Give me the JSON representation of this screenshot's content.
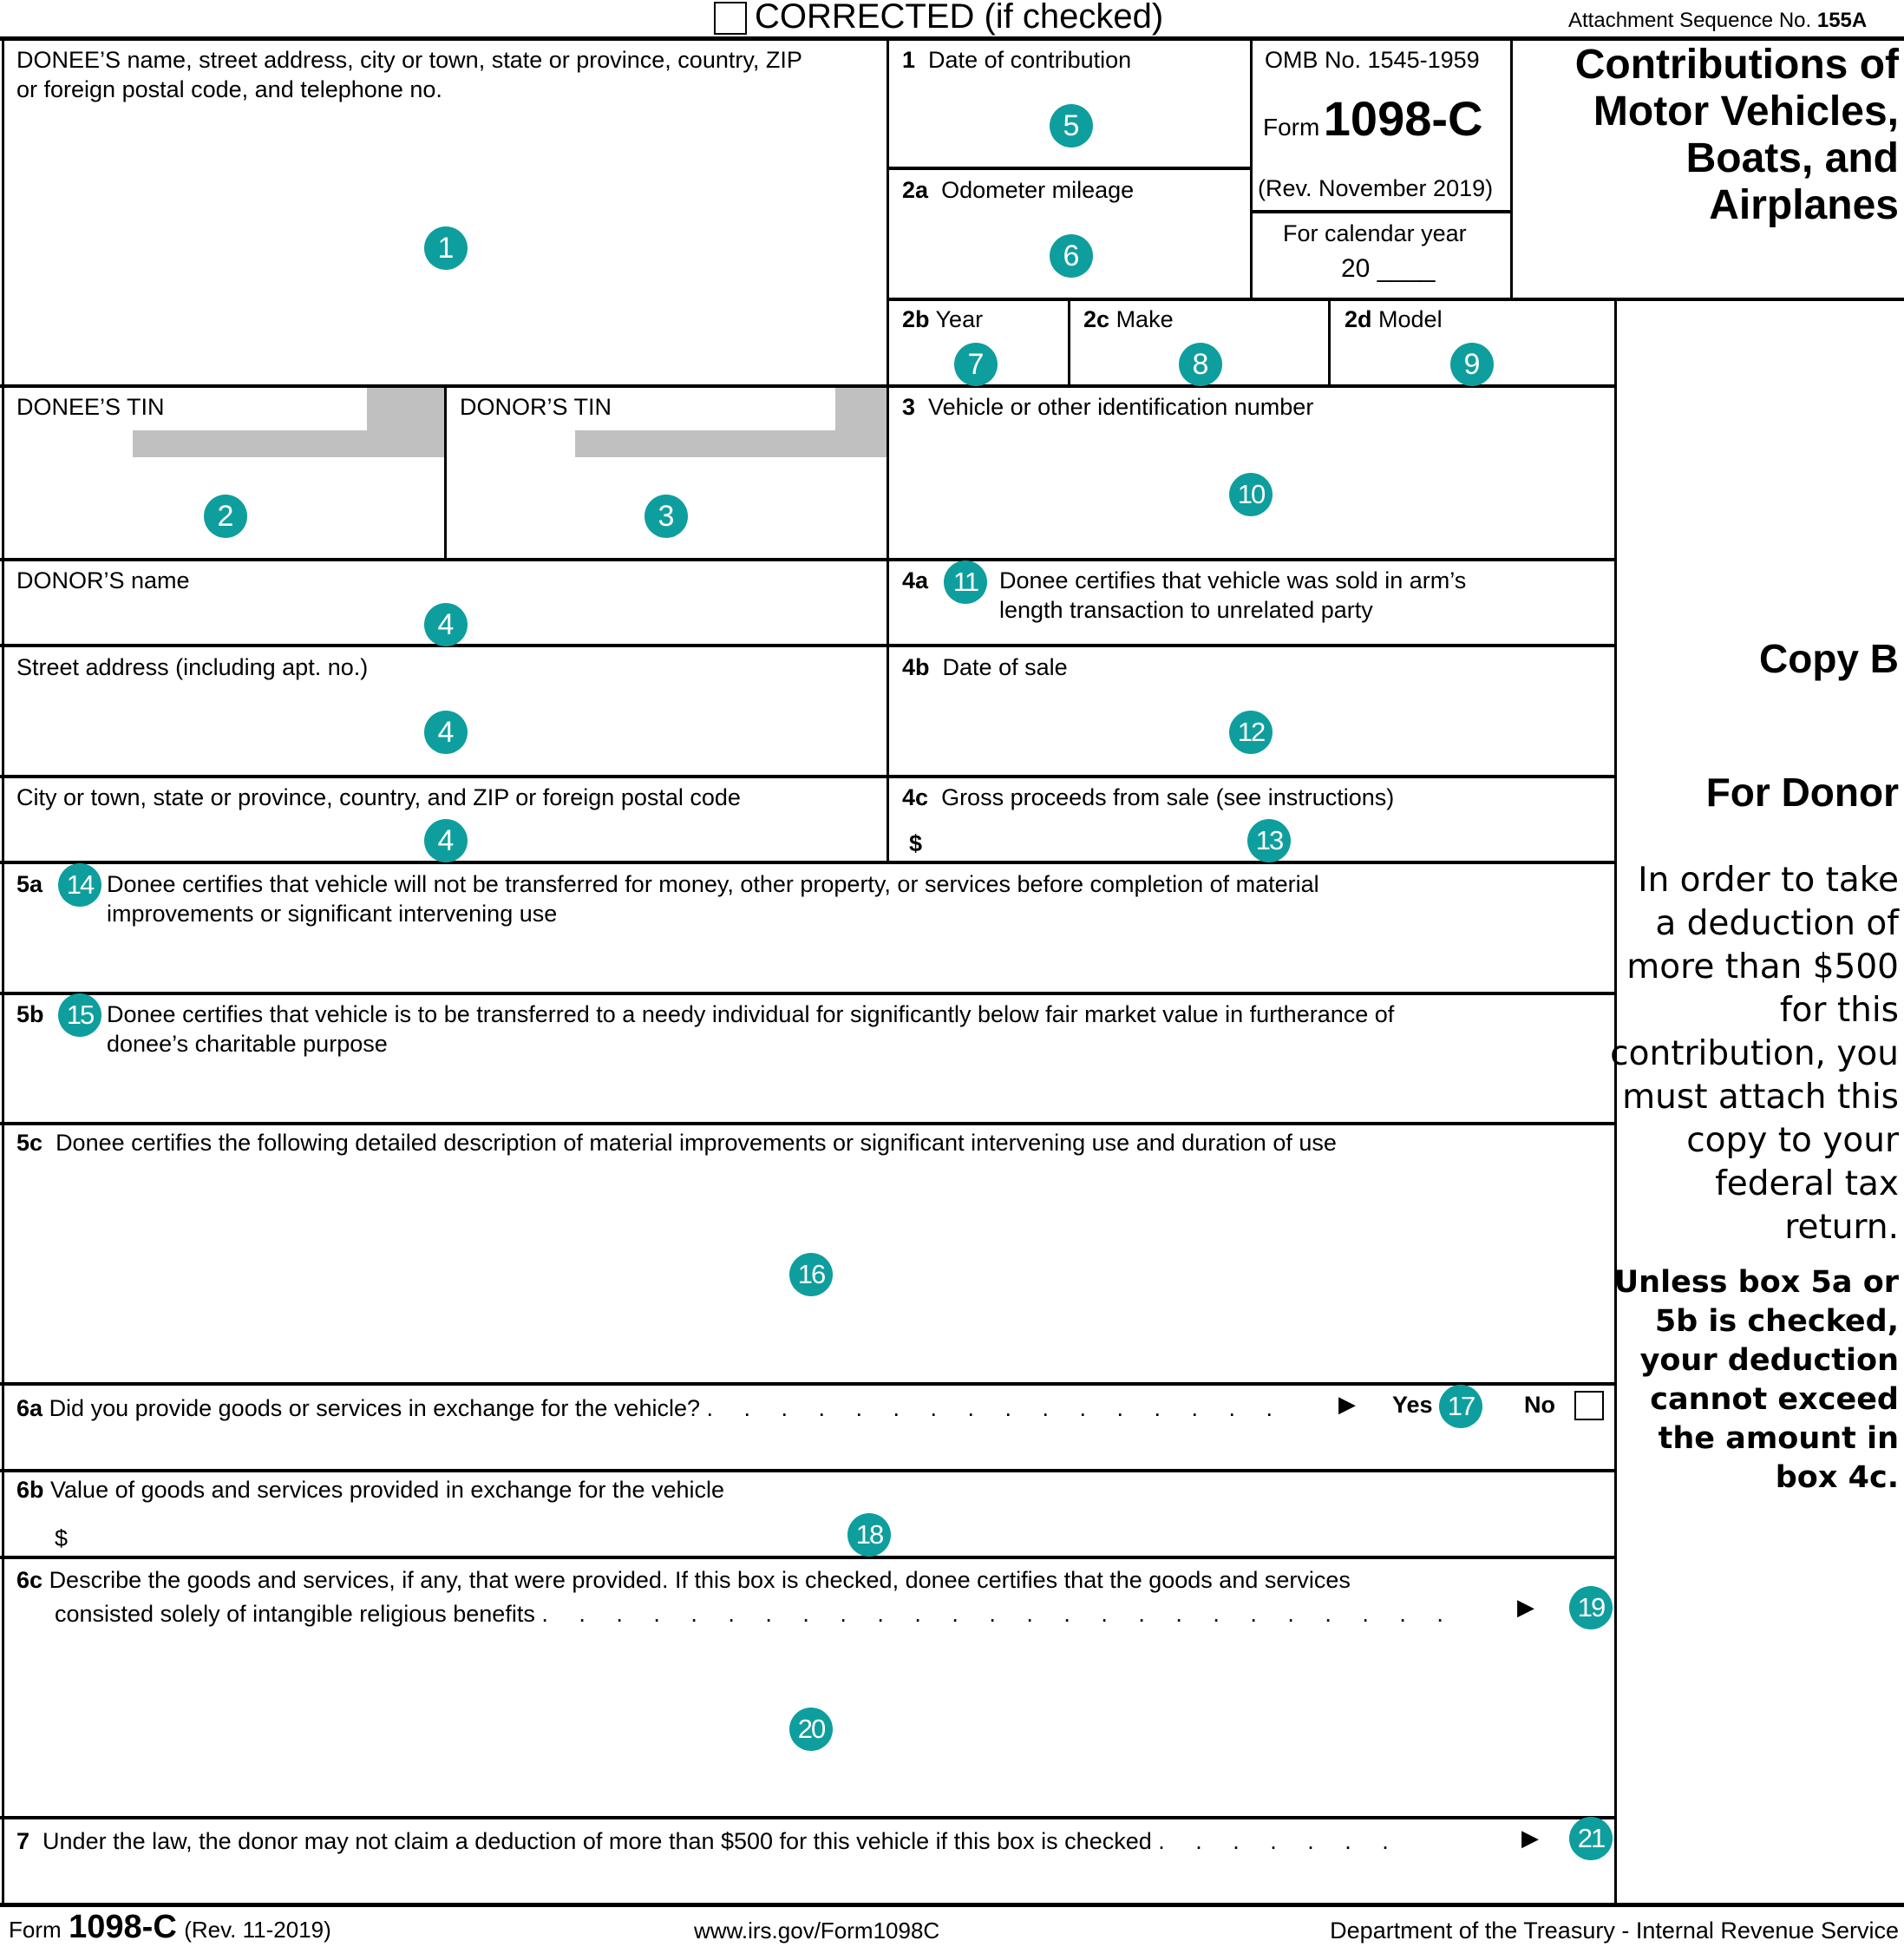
{
  "header": {
    "corrected_label": "CORRECTED (if checked)",
    "attachment_prefix": "Attachment Sequence No.",
    "attachment_no": "155A"
  },
  "form_id": {
    "omb": "OMB No. 1545-1959",
    "form_word": "Form",
    "form_number": "1098-C",
    "revision": "(Rev. November 2019)",
    "calendar_year_label": "For calendar year",
    "calendar_year_prefix": "20",
    "calendar_year_blank": "____"
  },
  "title": [
    "Contributions of",
    "Motor Vehicles,",
    "Boats, and",
    "Airplanes"
  ],
  "boxes": {
    "donee_info": {
      "line1": "DONEE’S name, street address, city or town, state or province, country, ZIP",
      "line2": "or foreign postal code, and telephone no.",
      "badge": "1"
    },
    "donee_tin": {
      "label": "DONEE’S TIN",
      "badge": "2"
    },
    "donor_tin": {
      "label": "DONOR’S TIN",
      "badge": "3"
    },
    "donor_name": {
      "label": "DONOR’S name",
      "badge": "4"
    },
    "street": {
      "label": "Street address (including apt. no.)",
      "badge": "4"
    },
    "city": {
      "label": "City or town, state or province, country, and ZIP or foreign postal code",
      "badge": "4"
    },
    "b1": {
      "num": "1",
      "label": "Date of contribution",
      "badge": "5"
    },
    "b2a": {
      "num": "2a",
      "label": "Odometer mileage",
      "badge": "6"
    },
    "b2b": {
      "num": "2b",
      "label": "Year",
      "badge": "7"
    },
    "b2c": {
      "num": "2c",
      "label": "Make",
      "badge": "8"
    },
    "b2d": {
      "num": "2d",
      "label": "Model",
      "badge": "9"
    },
    "b3": {
      "num": "3",
      "label": "Vehicle or other identification number",
      "badge": "10"
    },
    "b4a": {
      "num": "4a",
      "badge": "11",
      "line1": "Donee certifies that vehicle was sold in arm’s",
      "line2": "length transaction to unrelated party"
    },
    "b4b": {
      "num": "4b",
      "label": "Date of sale",
      "badge": "12"
    },
    "b4c": {
      "num": "4c",
      "label": "Gross proceeds from sale (see instructions)",
      "currency": "$",
      "badge": "13"
    },
    "b5a": {
      "num": "5a",
      "badge": "14",
      "line1": "Donee certifies that vehicle will not be transferred for money, other property, or services before completion of material",
      "line2": "improvements or significant intervening use"
    },
    "b5b": {
      "num": "5b",
      "badge": "15",
      "line1": "Donee certifies that vehicle is to be transferred to a needy individual for significantly below fair market value in furtherance of",
      "line2": "donee’s charitable purpose"
    },
    "b5c": {
      "num": "5c",
      "label": "Donee certifies the following detailed description of material improvements or significant intervening use and duration of use",
      "badge": "16"
    },
    "b6a": {
      "num": "6a",
      "label": "Did you provide goods or services in exchange for the vehicle?",
      "dots": ". . . . . . . . . . . . . . . .",
      "arrow": "▶",
      "yes_label": "Yes",
      "no_label": "No",
      "badge": "17"
    },
    "b6b": {
      "num": "6b",
      "label": "Value of goods and services provided in exchange for the vehicle",
      "currency": "$",
      "badge": "18"
    },
    "b6c": {
      "num": "6c",
      "line1": "Describe the goods and services, if any, that were provided. If this box is checked, donee certifies that the goods and services",
      "line2": "consisted solely of intangible religious benefits",
      "dots": ". . . . . . . . . . . . . . . . . . . . . . . . .",
      "arrow": "▶",
      "badge": "19",
      "badge2": "20"
    },
    "b7": {
      "num": "7",
      "label": "Under the law, the donor may not claim a deduction of more than $500 for this vehicle if this box is checked",
      "dots": ". . . . . . .",
      "arrow": "▶",
      "badge": "21"
    }
  },
  "side_panel": {
    "copy": "Copy B",
    "for": "For Donor",
    "instructions": [
      "In order to take",
      "a deduction of",
      "more than $500",
      "for this",
      "contribution, you",
      "must attach this",
      "copy to your",
      "federal tax",
      "return."
    ],
    "warning": [
      "Unless box 5a or",
      "5b is checked,",
      "your deduction",
      "cannot exceed",
      "the amount in",
      "box 4c."
    ]
  },
  "footer": {
    "form_word": "Form",
    "form_number": "1098-C",
    "revision": "(Rev. 11-2019)",
    "url": "www.irs.gov/Form1098C",
    "agency": "Department of the Treasury - Internal Revenue Service"
  },
  "colors": {
    "badge": "#0e9e9d",
    "shade": "#c0c0c0"
  }
}
